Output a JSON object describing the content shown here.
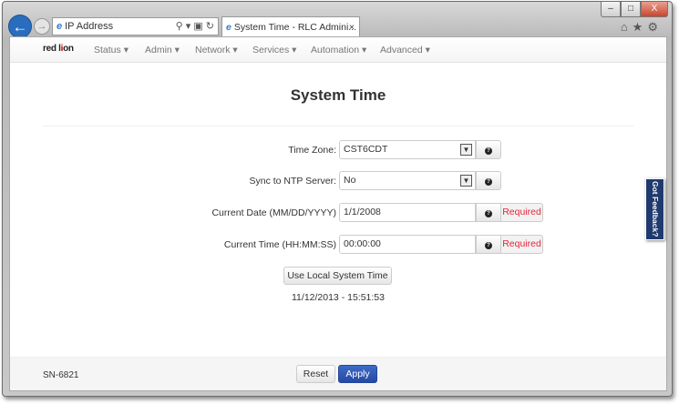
{
  "browser": {
    "address": "IP Address",
    "tab_title": "System Time - RLC Admini...",
    "tab_close": "×",
    "back": "←",
    "forward": "→",
    "minimize": "–",
    "maximize": "□",
    "close": "X",
    "tools": "⌂★⚙"
  },
  "nav": {
    "logo": "red lion",
    "items": [
      "Status",
      "Admin",
      "Network",
      "Services",
      "Automation",
      "Advanced"
    ]
  },
  "page": {
    "title": "System Time",
    "time_zone": {
      "label": "Time Zone:",
      "value": "CST6CDT"
    },
    "ntp": {
      "label": "Sync to NTP Server:",
      "value": "No"
    },
    "date": {
      "label": "Current Date (MM/DD/YYYY)",
      "value": "1/1/2008",
      "required": "Required"
    },
    "time": {
      "label": "Current Time (HH:MM:SS)",
      "value": "00:00:00",
      "required": "Required"
    },
    "use_local": "Use Local System Time",
    "local_time": "11/12/2013 - 15:51:53",
    "help": "?"
  },
  "footer": {
    "serial": "SN-6821",
    "reset": "Reset",
    "apply": "Apply"
  },
  "feedback": "Got Feedback?"
}
